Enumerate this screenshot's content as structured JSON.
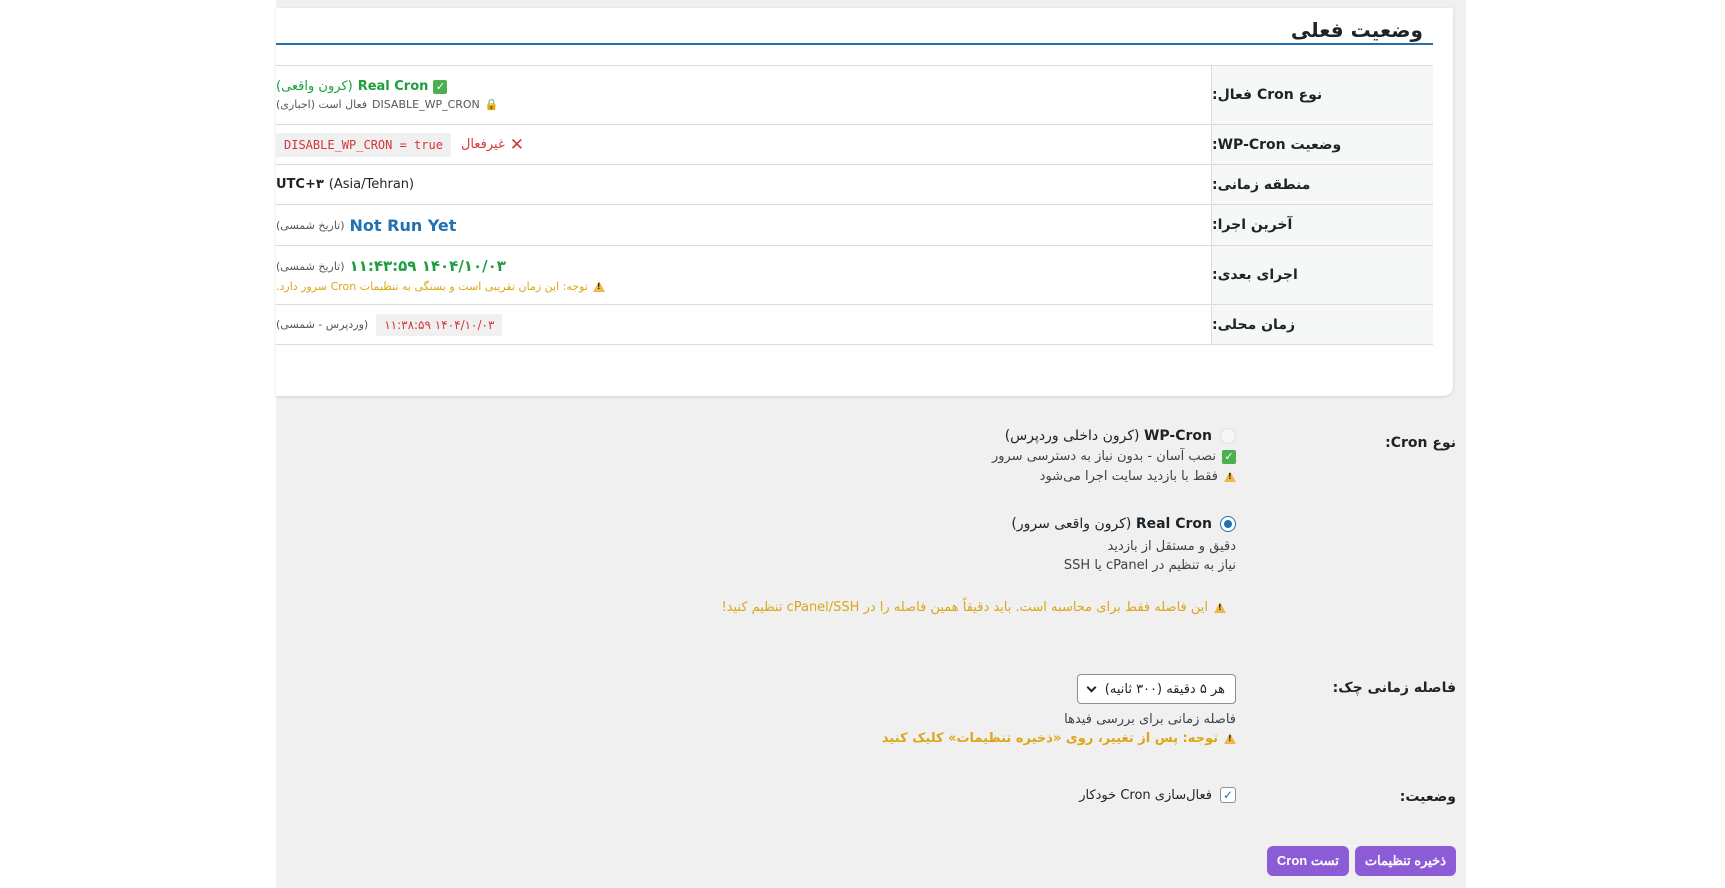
{
  "status_card": {
    "title": "وضعیت فعلی",
    "rows": {
      "cron_type": {
        "label": "نوع Cron فعال:",
        "value_main": "Real Cron",
        "value_paren": "(کرون واقعی)",
        "note_code": "DISABLE_WP_CRON",
        "note_text": "فعال است (اجباری)"
      },
      "wp_cron": {
        "label": "وضعیت WP-Cron:",
        "status": "غیرفعال",
        "code": "DISABLE_WP_CRON = true"
      },
      "timezone": {
        "label": "منطقه زمانی:",
        "offset": "UTC+۳",
        "zone": "(Asia/Tehran)"
      },
      "last_run": {
        "label": "آخرین اجرا:",
        "value": "Not Run Yet",
        "note": "(تاریخ شمسی)"
      },
      "next_run": {
        "label": "اجرای بعدی:",
        "value": "۱۴۰۴/۱۰/۰۳ ۱۱:۴۳:۵۹",
        "note": "(تاریخ شمسی)",
        "warning": "توجه: این زمان تقریبی است و بستگی به تنظیمات Cron سرور دارد."
      },
      "local_time": {
        "label": "زمان محلی:",
        "value": "۱۴۰۴/۱۰/۰۳ ۱۱:۳۸:۵۹",
        "note": "(وردپرس - شمسی)"
      }
    }
  },
  "settings": {
    "cron_type": {
      "label": "نوع Cron:",
      "options": [
        {
          "name": "WP-Cron",
          "desc": "(کرون داخلی وردپرس)",
          "selected": false,
          "lines": [
            "نصب آسان - بدون نیاز به دسترسی سرور",
            "فقط با بازدید سایت اجرا می‌شود"
          ]
        },
        {
          "name": "Real Cron",
          "desc": "(کرون واقعی سرور)",
          "selected": true,
          "lines": [
            "دقیق و مستقل از بازدید",
            "نیاز به تنظیم در cPanel یا SSH"
          ]
        }
      ],
      "warning": "این فاصله فقط برای محاسبه است. باید دقیقاً همین فاصله را در cPanel/SSH تنظیم کنید!"
    },
    "interval": {
      "label": "فاصله زمانی چک:",
      "selected": "هر ۵ دقیقه (۳۰۰ ثانیه)",
      "desc": "فاصله زمانی برای بررسی فیدها",
      "warning": "توجه: پس از تغییر، روی «ذخیره تنظیمات» کلیک کنید"
    },
    "status": {
      "label": "وضعیت:",
      "checkbox_label": "فعال‌سازی Cron خودکار",
      "checked": true
    }
  },
  "buttons": {
    "save": "ذخیره تنظیمات",
    "test": "تست Cron"
  },
  "colors": {
    "accent_blue": "#2271b1",
    "success_green": "#1e9e3e",
    "error_red": "#d63638",
    "warning_orange": "#dba617",
    "button_purple": "#8c5bd6"
  },
  "icons": {
    "checked": "check-square-icon",
    "lock": "lock-icon",
    "error": "x-icon",
    "warning": "warning-icon",
    "dropdown": "chevron-down-icon"
  }
}
